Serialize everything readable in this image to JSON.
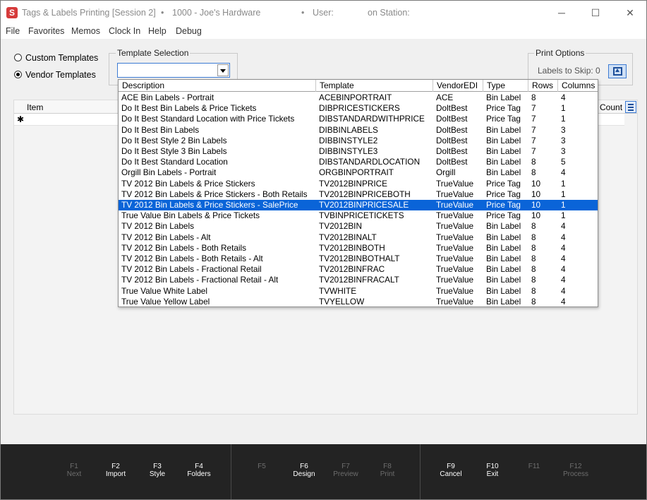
{
  "window": {
    "title_app": "Tags & Labels Printing [Session 2]",
    "title_sep1": "•",
    "title_store": "1000 - Joe's Hardware",
    "title_sep2": "•",
    "title_user": "User:",
    "title_station": "on Station:",
    "minimize": "─",
    "maximize": "☐",
    "close": "✕"
  },
  "menu": [
    "File",
    "Favorites",
    "Memos",
    "Clock In",
    "Help",
    "Debug"
  ],
  "templates_mode": {
    "custom_label": "Custom Templates",
    "vendor_label": "Vendor Templates",
    "selected": "Vendor Templates"
  },
  "template_selection": {
    "legend": "Template Selection",
    "value": ""
  },
  "print_options": {
    "legend": "Print Options",
    "skip_label": "Labels to Skip: 0"
  },
  "grid": {
    "col_item": "Item",
    "col_count": "Count",
    "new_row_marker": "✱"
  },
  "dropdown": {
    "headers": [
      "Description",
      "Template",
      "VendorEDI",
      "Type",
      "Rows",
      "Columns"
    ],
    "rows": [
      [
        "ACE Bin Labels - Portrait",
        "ACEBINPORTRAIT",
        "ACE",
        "Bin Label",
        "8",
        "4"
      ],
      [
        "Do It Best Bin Labels & Price Tickets",
        "DIBPRICESTICKERS",
        "DoltBest",
        "Price Tag",
        "7",
        "1"
      ],
      [
        "Do It Best Standard Location with Price Tickets",
        "DIBSTANDARDWITHPRICE",
        "DoltBest",
        "Price Tag",
        "7",
        "1"
      ],
      [
        "Do It Best Bin Labels",
        "DIBBINLABELS",
        "DoltBest",
        "Bin Label",
        "7",
        "3"
      ],
      [
        "Do It Best Style 2 Bin Labels",
        "DIBBINSTYLE2",
        "DoltBest",
        "Bin Label",
        "7",
        "3"
      ],
      [
        "Do It Best Style 3 Bin Labels",
        "DIBBINSTYLE3",
        "DoltBest",
        "Bin Label",
        "7",
        "3"
      ],
      [
        "Do It Best Standard Location",
        "DIBSTANDARDLOCATION",
        "DoltBest",
        "Bin Label",
        "8",
        "5"
      ],
      [
        "Orgill Bin Labels - Portrait",
        "ORGBINPORTRAIT",
        "Orgill",
        "Bin Label",
        "8",
        "4"
      ],
      [
        "TV 2012 Bin Labels & Price Stickers",
        "TV2012BINPRICE",
        "TrueValue",
        "Price Tag",
        "10",
        "1"
      ],
      [
        "TV 2012 Bin Labels & Price Stickers - Both Retails",
        "TV2012BINPRICEBOTH",
        "TrueValue",
        "Price Tag",
        "10",
        "1"
      ],
      [
        "TV 2012 Bin Labels & Price Stickers - SalePrice",
        "TV2012BINPRICESALE",
        "TrueValue",
        "Price Tag",
        "10",
        "1"
      ],
      [
        "True Value Bin Labels & Price Tickets",
        "TVBINPRICETICKETS",
        "TrueValue",
        "Price Tag",
        "10",
        "1"
      ],
      [
        "TV 2012 Bin Labels",
        "TV2012BIN",
        "TrueValue",
        "Bin Label",
        "8",
        "4"
      ],
      [
        "TV 2012 Bin Labels - Alt",
        "TV2012BINALT",
        "TrueValue",
        "Bin Label",
        "8",
        "4"
      ],
      [
        "TV 2012 Bin Labels - Both Retails",
        "TV2012BINBOTH",
        "TrueValue",
        "Bin Label",
        "8",
        "4"
      ],
      [
        "TV 2012 Bin Labels - Both Retails - Alt",
        "TV2012BINBOTHALT",
        "TrueValue",
        "Bin Label",
        "8",
        "4"
      ],
      [
        "TV 2012 Bin Labels - Fractional Retail",
        "TV2012BINFRAC",
        "TrueValue",
        "Bin Label",
        "8",
        "4"
      ],
      [
        "TV 2012 Bin Labels - Fractional Retail - Alt",
        "TV2012BINFRACALT",
        "TrueValue",
        "Bin Label",
        "8",
        "4"
      ],
      [
        "True Value White Label",
        "TVWHITE",
        "TrueValue",
        "Bin Label",
        "8",
        "4"
      ],
      [
        "True Value Yellow Label",
        "TVYELLOW",
        "TrueValue",
        "Bin Label",
        "8",
        "4"
      ]
    ],
    "selected_index": 10
  },
  "fkeys": [
    {
      "key": "F1",
      "label": "Next",
      "enabled": false
    },
    {
      "key": "F2",
      "label": "Import",
      "enabled": true
    },
    {
      "key": "F3",
      "label": "Style",
      "enabled": true
    },
    {
      "key": "F4",
      "label": "Folders",
      "enabled": true
    },
    {
      "key": "F5",
      "label": "",
      "enabled": false
    },
    {
      "key": "F6",
      "label": "Design",
      "enabled": true
    },
    {
      "key": "F7",
      "label": "Preview",
      "enabled": false
    },
    {
      "key": "F8",
      "label": "Print",
      "enabled": false
    },
    {
      "key": "F9",
      "label": "Cancel",
      "enabled": true
    },
    {
      "key": "F10",
      "label": "Exit",
      "enabled": true
    },
    {
      "key": "F11",
      "label": "",
      "enabled": false
    },
    {
      "key": "F12",
      "label": "Process",
      "enabled": false
    }
  ],
  "colors": {
    "accent": "#0a64d8",
    "app_icon": "#d63b3b",
    "fkey_bar": "#232323"
  }
}
